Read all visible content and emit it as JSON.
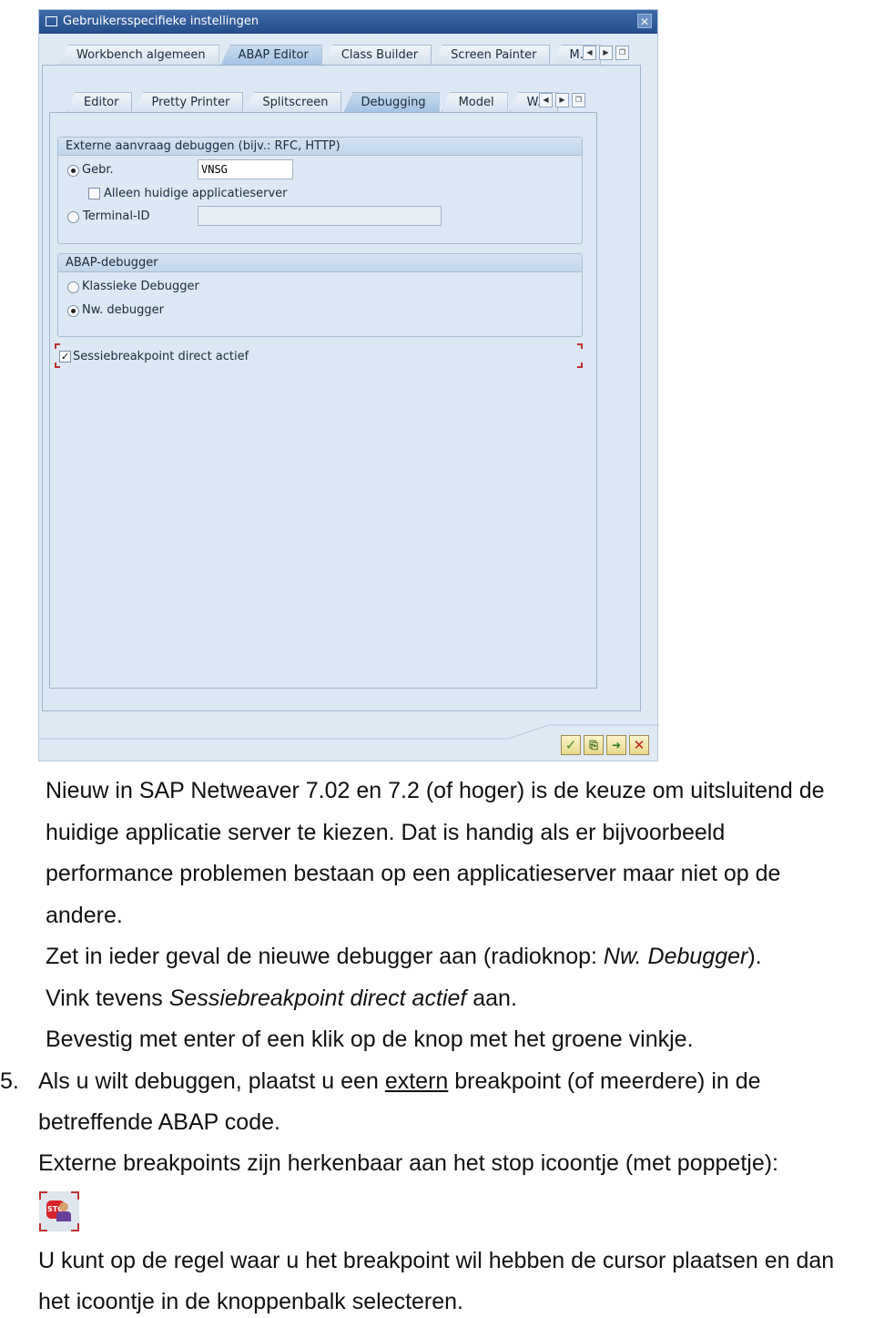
{
  "dialog": {
    "title": "Gebruikersspecifieke instellingen",
    "outer_tabs": [
      "Workbench algemeen",
      "ABAP Editor",
      "Class Builder",
      "Screen Painter",
      "M.."
    ],
    "outer_active": "ABAP Editor",
    "inner_tabs": [
      "Editor",
      "Pretty Printer",
      "Splitscreen",
      "Debugging",
      "Model",
      "W.."
    ],
    "inner_active": "Debugging",
    "external_group": {
      "title": "Externe aanvraag debuggen (bijv.: RFC, HTTP)",
      "user_label": "Gebr.",
      "user_value": "VNSG",
      "user_selected": true,
      "current_server_label": "Alleen huidige applicatieserver",
      "current_server_checked": false,
      "terminal_label": "Terminal-ID",
      "terminal_value": "",
      "terminal_selected": false
    },
    "debugger_group": {
      "title": "ABAP-debugger",
      "classic_label": "Klassieke Debugger",
      "classic_selected": false,
      "new_label": "Nw. debugger",
      "new_selected": true
    },
    "session_bp": {
      "label": "Sessiebreakpoint direct actief",
      "checked": true
    },
    "footer_buttons": [
      "confirm-icon",
      "copy-icon",
      "transfer-icon",
      "cancel-icon"
    ]
  },
  "doc": {
    "p1": [
      "Nieuw in SAP Netweaver 7.02 en 7.2 (of hoger) is de keuze om uitsluitend de",
      "huidige applicatie server te kiezen. Dat is handig als er bijvoorbeeld",
      "performance problemen bestaan op een applicatieserver maar niet op de",
      "andere."
    ],
    "p2_pre": "Zet in ieder geval de nieuwe debugger aan (radioknop: ",
    "p2_em": "Nw. Debugger",
    "p2_post": ").",
    "p3_pre": "Vink tevens ",
    "p3_em": "Sessiebreakpoint direct actief",
    "p3_post": " aan.",
    "p4": "Bevestig met enter of een klik op de knop met het groene vinkje.",
    "item5_num": "5.",
    "item5_pre": "Als u wilt debuggen, plaatst u een ",
    "item5_link": "extern",
    "item5_post": " breakpoint (of meerdere) in de",
    "item5_l2": "betreffende ABAP code.",
    "item5_l3": "Externe breakpoints zijn herkenbaar aan het stop icoontje (met poppetje):",
    "icon_text": "STO",
    "p6": [
      "U kunt op de regel waar u het breakpoint wil hebben de cursor plaatsen en dan",
      "het icoontje in de knoppenbalk selecteren."
    ]
  }
}
